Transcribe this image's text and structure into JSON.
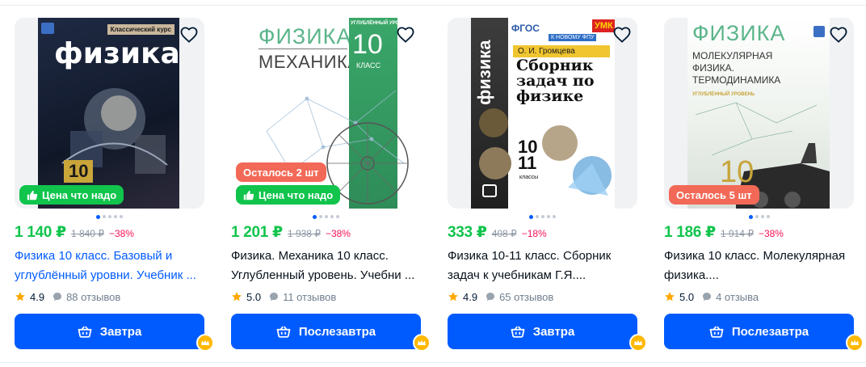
{
  "products": [
    {
      "cover_title": "физика",
      "cover_series": "Классический курс",
      "cover_grade": "10",
      "badges": [
        {
          "text": "Цена что надо",
          "type": "green",
          "icon": "thumbs-up-icon"
        }
      ],
      "price": "1 140 ₽",
      "old_price": "1 840 ₽",
      "discount": "−38%",
      "title": "Физика 10 класс. Базовый и углублённый уровни. Учебник ...",
      "rating": "4.9",
      "reviews": "88 отзывов",
      "button": "Завтра"
    },
    {
      "cover_title": "ФИЗИКА",
      "cover_subtitle": "МЕХАНИКА",
      "cover_level": "УГЛУБЛЁННЫЙ УРОВЕНЬ",
      "cover_grade": "10",
      "cover_grade_word": "КЛАСС",
      "badges": [
        {
          "text": "Осталось 2 шт",
          "type": "orange",
          "icon": ""
        },
        {
          "text": "Цена что надо",
          "type": "green",
          "icon": "thumbs-up-icon"
        }
      ],
      "price": "1 201 ₽",
      "old_price": "1 938 ₽",
      "discount": "−38%",
      "title": "Физика. Механика 10 класс. Углубленный уровень. Учебни ...",
      "rating": "5.0",
      "reviews": "11 отзывов",
      "button": "Послезавтра"
    },
    {
      "cover_title": "физика",
      "cover_fgos": "ФГОС",
      "cover_umk": "УМК",
      "cover_fpu": "К НОВОМУ ФПУ",
      "cover_author": "О. И. Громцева",
      "cover_main": "Сборник задач по физике",
      "cover_grade": "10 11",
      "cover_grade_word": "классы",
      "badges": [],
      "price": "333 ₽",
      "old_price": "408 ₽",
      "discount": "−18%",
      "title": "Физика 10-11 класс. Сборник задач к учебникам Г.Я....",
      "rating": "4.9",
      "reviews": "65 отзывов",
      "button": "Завтра"
    },
    {
      "cover_title": "ФИЗИКА",
      "cover_subtitle": "МОЛЕКУЛЯРНАЯ ФИЗИКА. ТЕРМОДИНАМИКА",
      "cover_level": "УГЛУБЛЁННЫЙ УРОВЕНЬ",
      "cover_grade": "10",
      "badges": [
        {
          "text": "Осталось 5 шт",
          "type": "orange",
          "icon": ""
        }
      ],
      "price": "1 186 ₽",
      "old_price": "1 914 ₽",
      "discount": "−38%",
      "title": "Физика 10 класс. Молекулярная физика....",
      "rating": "5.0",
      "reviews": "4 отзыва",
      "button": "Послезавтра"
    }
  ],
  "colors": {
    "accent": "#005bff",
    "price": "#10c44c",
    "discount": "#f91155",
    "badge_green": "#10c44c",
    "badge_orange": "#f26957",
    "star": "#ffa800"
  }
}
